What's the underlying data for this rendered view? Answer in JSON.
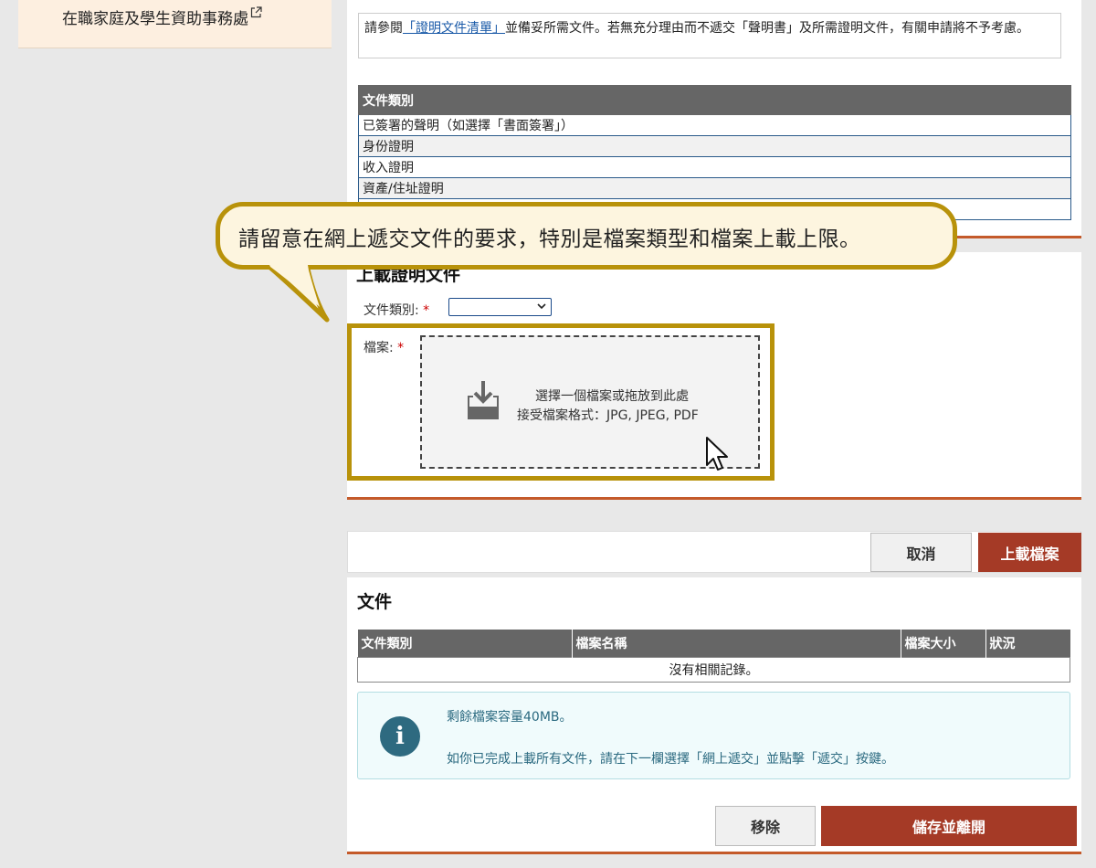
{
  "sidebar": {
    "link_label": "在職家庭及學生資助事務處"
  },
  "notice": {
    "prefix": "請參閱",
    "link": "「證明文件清單」",
    "suffix": "並備妥所需文件。若無充分理由而不遞交「聲明書」及所需證明文件，有關申請將不予考慮。"
  },
  "doc_types_table": {
    "header": "文件類別",
    "rows": [
      "已簽署的聲明（如選擇「書面簽署」）",
      "身份證明",
      "收入證明",
      "資產/住址證明",
      ""
    ]
  },
  "upload": {
    "title": "上載證明文件",
    "doc_type_label": "文件類別:",
    "doc_type_value": "",
    "file_label": "檔案:",
    "required_mark": "*",
    "dropzone_line1": "選擇一個檔案或拖放到此處",
    "dropzone_line2": "接受檔案格式：JPG, JPEG, PDF"
  },
  "actions": {
    "cancel": "取消",
    "upload": "上載檔案"
  },
  "files": {
    "title": "文件",
    "columns": [
      "文件類別",
      "檔案名稱",
      "檔案大小",
      "狀況"
    ],
    "empty_text": "沒有相關記錄。",
    "info_line1": "剩餘檔案容量40MB。",
    "info_line2": "如你已完成上載所有文件，請在下一欄選擇「網上遞交」並點擊「遞交」按鍵。"
  },
  "bottom_actions": {
    "remove": "移除",
    "save_exit": "儲存並離開"
  },
  "callout": {
    "text": "請留意在網上遞交文件的要求，特別是檔案類型和檔案上載上限。"
  },
  "colors": {
    "accent": "#a53a26",
    "highlight": "#b8920a",
    "info_text": "#2b6a80",
    "rule": "#c45a2a"
  }
}
